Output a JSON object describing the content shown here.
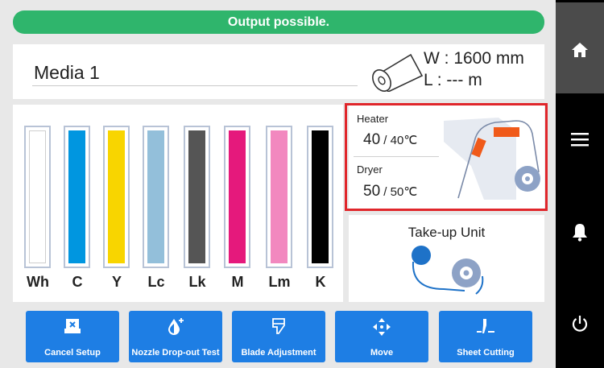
{
  "status": {
    "message": "Output possible.",
    "color": "#2fb56c"
  },
  "media": {
    "name": "Media 1",
    "width_line": "W : 1600 mm",
    "length_line": "L : --- m"
  },
  "inks": [
    {
      "label": "Wh",
      "color": "#ffffff"
    },
    {
      "label": "C",
      "color": "#0096e0"
    },
    {
      "label": "Y",
      "color": "#f8d500"
    },
    {
      "label": "Lc",
      "color": "#93bfda"
    },
    {
      "label": "Lk",
      "color": "#555555"
    },
    {
      "label": "M",
      "color": "#e5197c"
    },
    {
      "label": "Lm",
      "color": "#f288bf"
    },
    {
      "label": "K",
      "color": "#000000"
    }
  ],
  "heater": {
    "heater_label": "Heater",
    "heater_current": "40",
    "heater_setting": " / 40℃",
    "dryer_label": "Dryer",
    "dryer_current": "50",
    "dryer_setting": " / 50℃",
    "highlight_color": "#e0262b"
  },
  "takeup": {
    "label": "Take-up Unit"
  },
  "toolbar": {
    "buttons": [
      {
        "label": "Cancel Setup",
        "icon": "cancel-setup-icon"
      },
      {
        "label": "Nozzle Drop-out Test",
        "icon": "nozzle-drop-icon"
      },
      {
        "label": "Blade Adjustment",
        "icon": "blade-icon"
      },
      {
        "label": "Move",
        "icon": "move-arrows-icon"
      },
      {
        "label": "Sheet Cutting",
        "icon": "sheet-cutting-icon"
      }
    ],
    "color": "#1e7ee4"
  },
  "sidebar": {
    "icons": [
      "home-icon",
      "menu-icon",
      "bell-icon",
      "power-icon"
    ]
  }
}
